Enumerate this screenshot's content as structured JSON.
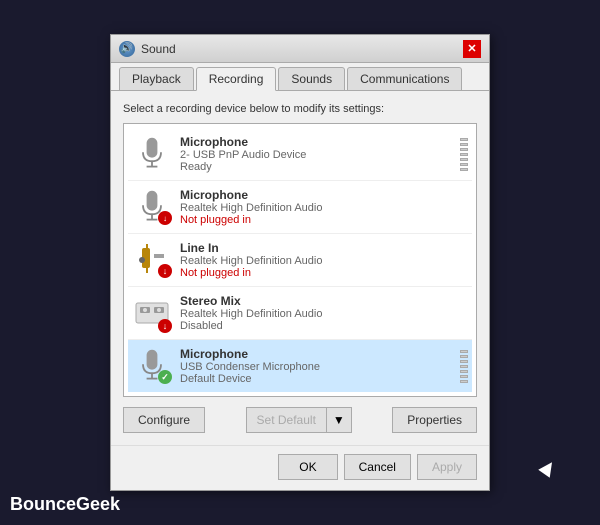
{
  "window": {
    "title": "Sound",
    "close_label": "✕"
  },
  "tabs": [
    {
      "id": "playback",
      "label": "Playback"
    },
    {
      "id": "recording",
      "label": "Recording"
    },
    {
      "id": "sounds",
      "label": "Sounds"
    },
    {
      "id": "communications",
      "label": "Communications"
    }
  ],
  "active_tab": "recording",
  "instruction": "Select a recording device below to modify its settings:",
  "devices": [
    {
      "id": "mic-usb",
      "name": "Microphone",
      "description": "2- USB PnP Audio Device",
      "status": "Ready",
      "status_class": "status-ready",
      "badge": null,
      "has_bars": true,
      "selected": false
    },
    {
      "id": "mic-realtek",
      "name": "Microphone",
      "description": "Realtek High Definition Audio",
      "status": "Not plugged in",
      "status_class": "status-plugged-out",
      "badge": "red",
      "has_bars": false,
      "selected": false
    },
    {
      "id": "line-in",
      "name": "Line In",
      "description": "Realtek High Definition Audio",
      "status": "Not plugged in",
      "status_class": "status-plugged-out",
      "badge": "red",
      "has_bars": false,
      "selected": false
    },
    {
      "id": "stereo-mix",
      "name": "Stereo Mix",
      "description": "Realtek High Definition Audio",
      "status": "Disabled",
      "status_class": "status-disabled",
      "badge": "down",
      "has_bars": false,
      "selected": false
    },
    {
      "id": "mic-condenser",
      "name": "Microphone",
      "description": "USB Condenser Microphone",
      "status": "Default Device",
      "status_class": "status-default",
      "badge": "green",
      "has_bars": true,
      "selected": true
    }
  ],
  "buttons": {
    "configure": "Configure",
    "set_default": "Set Default",
    "properties": "Properties",
    "ok": "OK",
    "cancel": "Cancel",
    "apply": "Apply"
  },
  "watermark": "BounceGeek"
}
